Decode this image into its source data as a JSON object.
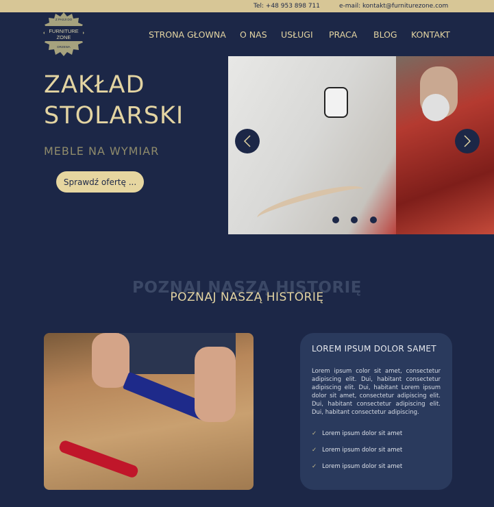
{
  "topbar": {
    "phone": "Tel: +48 953 898 711",
    "email": "e-mail: kontakt@furniturezone.com"
  },
  "logo": {
    "text": "Z PASJI DO EST FURNITURE ZONE 2000 DRZEWA"
  },
  "nav": [
    "STRONA GŁOWNA",
    "O NAS",
    "USŁUGI",
    "PRACA",
    "BLOG",
    "KONTAKT"
  ],
  "hero": {
    "title_line1": "ZAKŁAD",
    "title_line2": "STOLARSKI",
    "subtitle": "MEBLE NA WYMIAR",
    "button": "Sprawdź ofertę ...",
    "slides": 3
  },
  "section": {
    "watermark": "POZNAJ NASZĄ HISTORIĘ",
    "title": "POZNAJ NASZĄ HISTORIĘ"
  },
  "card": {
    "title": "LOREM IPSUM DOLOR SAMET",
    "body": "Lorem ipsum color sit amet, consectetur adipiscing elit. Dui, habitant consectetur adipiscing elit. Dui, habitant Lorem ipsum dolor sit amet, consectetur adipiscing elit. Dui, habitant consectetur adipiscing elit. Dui, habitant consectetur adipiscing.",
    "check": "✓",
    "items": [
      "Lorem ipsum dolor sit amet",
      "Lorem ipsum dolor sit amet",
      "Lorem ipsum dolor sit amet"
    ]
  },
  "colors": {
    "background": "#1c2747",
    "gold": "#e3d4a2",
    "topbar": "#d7c696",
    "card": "#2a3a5d"
  }
}
